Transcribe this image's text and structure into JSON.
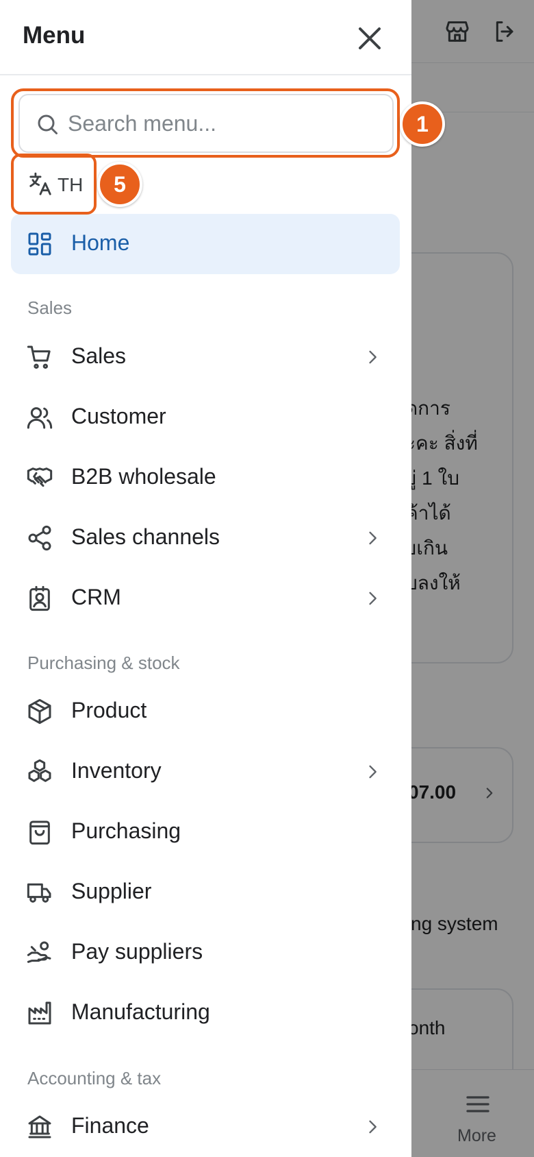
{
  "background": {
    "card_text_lines": [
      "ดการ",
      "ะคะ สิ่งที่",
      "ยู่ 1 ใบ",
      "ค้าได้",
      "ยเกิน",
      "บลงให้"
    ],
    "card_value": "07.00",
    "text_row": "ng system",
    "card3_text": "onth",
    "more_label": "More"
  },
  "drawer": {
    "title": "Menu",
    "search": {
      "placeholder": "Search menu...",
      "value": ""
    },
    "language": {
      "label": "TH"
    },
    "home": {
      "label": "Home",
      "icon": "dashboard-icon"
    },
    "sections": [
      {
        "title": "Sales",
        "items": [
          {
            "label": "Sales",
            "icon": "cart-icon",
            "has_submenu": true
          },
          {
            "label": "Customer",
            "icon": "users-icon",
            "has_submenu": false
          },
          {
            "label": "B2B wholesale",
            "icon": "handshake-icon",
            "has_submenu": false
          },
          {
            "label": "Sales channels",
            "icon": "share-icon",
            "has_submenu": true
          },
          {
            "label": "CRM",
            "icon": "contact-badge-icon",
            "has_submenu": true
          }
        ]
      },
      {
        "title": "Purchasing & stock",
        "items": [
          {
            "label": "Product",
            "icon": "box-icon",
            "has_submenu": false
          },
          {
            "label": "Inventory",
            "icon": "boxes-icon",
            "has_submenu": true
          },
          {
            "label": "Purchasing",
            "icon": "shopping-bag-icon",
            "has_submenu": false
          },
          {
            "label": "Supplier",
            "icon": "truck-icon",
            "has_submenu": false
          },
          {
            "label": "Pay suppliers",
            "icon": "hand-coins-icon",
            "has_submenu": false
          },
          {
            "label": "Manufacturing",
            "icon": "factory-icon",
            "has_submenu": false
          }
        ]
      },
      {
        "title": "Accounting & tax",
        "items": [
          {
            "label": "Finance",
            "icon": "bank-icon",
            "has_submenu": true
          }
        ]
      }
    ]
  },
  "annotations": {
    "search_badge": "1",
    "language_badge": "5",
    "color": "#e8601c"
  },
  "colors": {
    "active_bg": "#e8f1fc",
    "active_text": "#1a5ea8",
    "overlay": "rgba(0,0,0,0.42)"
  }
}
